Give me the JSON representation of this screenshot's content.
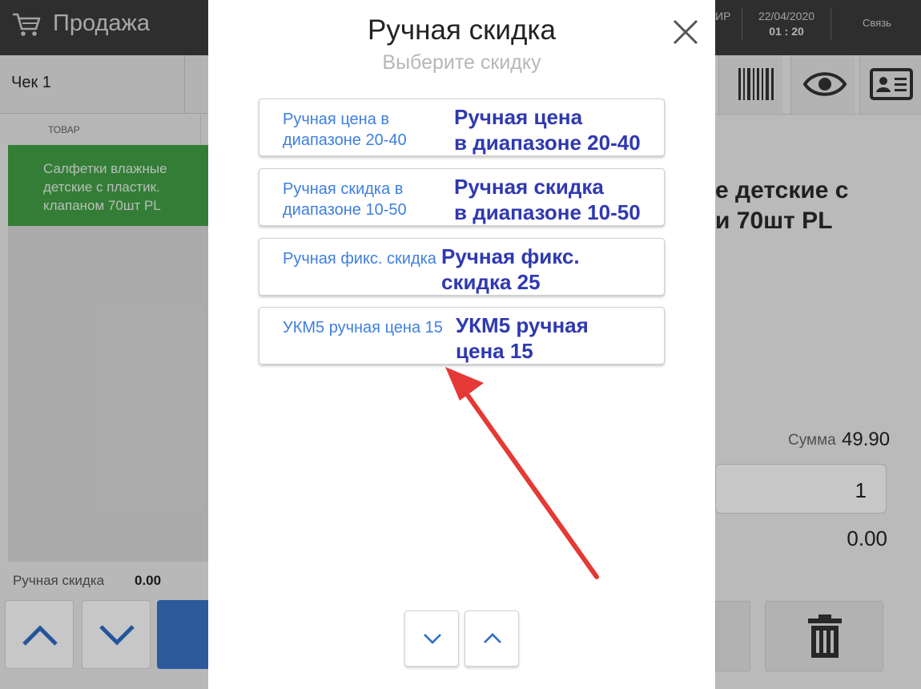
{
  "app": {
    "title": "Продажа",
    "operator_partial": "ИР",
    "date": "22/04/2020",
    "time": "01 : 20",
    "connection": "Связь"
  },
  "receipt": {
    "tab_label": "Чек 1",
    "column_header": "ТОВАР",
    "items": [
      {
        "name": "Салфетки влажные детские с пластик. клапаном 70шт PL"
      }
    ]
  },
  "footer": {
    "manual_discount_label": "Ручная скидка",
    "manual_discount_value": "0.00"
  },
  "details": {
    "product_name_line1": "е детские с",
    "product_name_line2": "и 70шт PL",
    "sum_label": "Сумма",
    "sum_value": "49.90",
    "quantity": "1",
    "discount_value": "0.00"
  },
  "modal": {
    "title": "Ручная скидка",
    "subtitle": "Выберите скидку",
    "options": [
      {
        "label": "Ручная цена в диапазоне 20-40",
        "title": "Ручная цена в диапазоне 20-40"
      },
      {
        "label": "Ручная скидка в диапазоне 10-50",
        "title": "Ручная скидка в диапазоне 10-50"
      },
      {
        "label": "Ручная фикс. скидка",
        "title": "Ручная фикс. скидка 25"
      },
      {
        "label": "УКМ5 ручная цена 15",
        "title": "УКМ5 ручная цена 15"
      }
    ]
  },
  "colors": {
    "topbar": "#3c3c3c",
    "selected_row": "#43a047",
    "option_label": "#3d7fe0",
    "option_title": "#2f39b0",
    "annotation_arrow": "#e53935",
    "primary_button": "#3a74c9"
  }
}
